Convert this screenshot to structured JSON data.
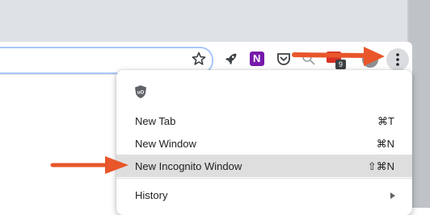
{
  "toolbar": {
    "extensions": [
      "star-icon",
      "rocket-icon",
      "onenote-icon",
      "pocket-icon",
      "search-icon",
      "gmail-icon",
      "avatar"
    ],
    "gmail_badge": "9",
    "onenote_letter": "N"
  },
  "menu": {
    "extension_icon": "ublock-icon",
    "items": [
      {
        "label": "New Tab",
        "shortcut": "⌘T"
      },
      {
        "label": "New Window",
        "shortcut": "⌘N"
      },
      {
        "label": "New Incognito Window",
        "shortcut": "⇧⌘N"
      },
      {
        "label": "History",
        "shortcut": ""
      }
    ]
  },
  "colors": {
    "arrow": "#e8562a",
    "highlight": "#dedede",
    "onenote": "#7719aa"
  }
}
